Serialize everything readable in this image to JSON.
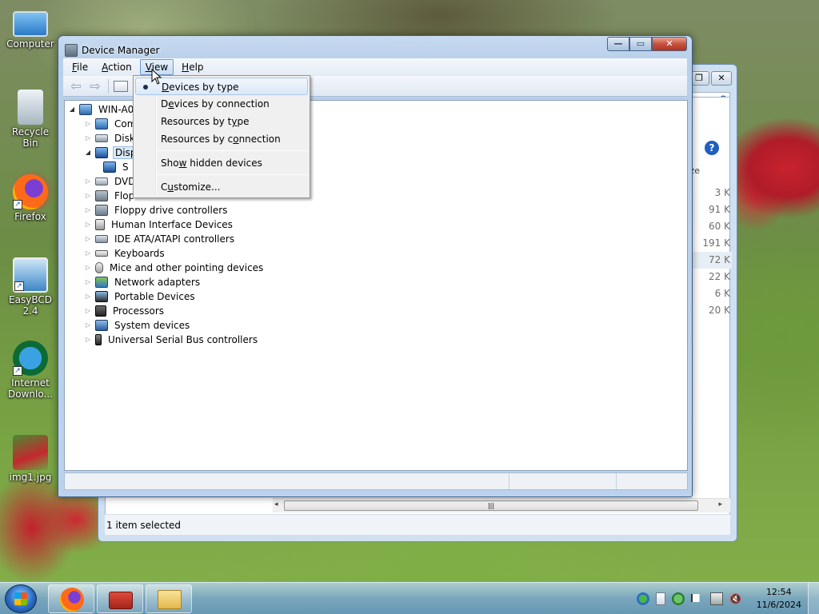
{
  "desktop": {
    "icons": [
      {
        "label": "Computer",
        "icon": "computer-icon"
      },
      {
        "label": "Recycle Bin",
        "icon": "recycle-bin-icon"
      },
      {
        "label": "Firefox",
        "icon": "firefox-icon"
      },
      {
        "label": "EasyBCD 2.4",
        "icon": "easybcd-icon"
      },
      {
        "label": "Internet Downlo...",
        "icon": "internet-download-manager-icon"
      },
      {
        "label": "img1.jpg",
        "icon": "image-file-icon"
      }
    ]
  },
  "background_window": {
    "sizes": [
      "3 K",
      "91 K",
      "60 K",
      "191 K",
      "72 K",
      "22 K",
      "6 K",
      "20 K"
    ],
    "column_fragment": "ze",
    "status": "1 item selected"
  },
  "device_manager": {
    "title": "Device Manager",
    "menu": {
      "file": {
        "pre": "",
        "acc": "F",
        "post": "ile"
      },
      "action": {
        "pre": "",
        "acc": "A",
        "post": "ction"
      },
      "view": {
        "pre": "",
        "acc": "V",
        "post": "iew"
      },
      "help": {
        "pre": "",
        "acc": "H",
        "post": "elp"
      }
    },
    "tree": {
      "root": "WIN-A0",
      "items": [
        {
          "label": "Com",
          "icon": "computer-icon"
        },
        {
          "label": "Disk",
          "icon": "disk-drive-icon"
        },
        {
          "label": "Disp",
          "icon": "display-adapter-icon",
          "expanded": true
        },
        {
          "label": "S",
          "icon": "display-adapter-icon",
          "child": true
        },
        {
          "label": "DVD",
          "icon": "dvd-drive-icon"
        },
        {
          "label": "Flop",
          "icon": "floppy-disk-icon"
        },
        {
          "label": "Floppy drive controllers",
          "icon": "floppy-controller-icon"
        },
        {
          "label": "Human Interface Devices",
          "icon": "hid-icon"
        },
        {
          "label": "IDE ATA/ATAPI controllers",
          "icon": "ide-controller-icon"
        },
        {
          "label": "Keyboards",
          "icon": "keyboard-icon"
        },
        {
          "label": "Mice and other pointing devices",
          "icon": "mouse-icon"
        },
        {
          "label": "Network adapters",
          "icon": "network-adapter-icon"
        },
        {
          "label": "Portable Devices",
          "icon": "portable-device-icon"
        },
        {
          "label": "Processors",
          "icon": "processor-icon"
        },
        {
          "label": "System devices",
          "icon": "system-devices-icon"
        },
        {
          "label": "Universal Serial Bus controllers",
          "icon": "usb-icon"
        }
      ]
    }
  },
  "view_menu": {
    "items": [
      {
        "pre": "",
        "acc": "D",
        "post": "evices by type",
        "checked": true
      },
      {
        "pre": "D",
        "acc": "e",
        "post": "vices by connection"
      },
      {
        "pre": "Resources by t",
        "acc": "y",
        "post": "pe"
      },
      {
        "pre": "Resources by c",
        "acc": "o",
        "post": "nnection"
      },
      {
        "pre": "Sho",
        "acc": "w",
        "post": " hidden devices"
      },
      {
        "pre": "C",
        "acc": "u",
        "post": "stomize..."
      }
    ]
  },
  "taskbar": {
    "apps": [
      "firefox-icon",
      "toolbox-icon",
      "file-explorer-icon"
    ],
    "tray_icons": [
      "network-icon",
      "clipboard-icon",
      "security-icon",
      "action-center-flag-icon",
      "printer-icon",
      "volume-muted-icon"
    ],
    "time": "12:54",
    "date": "11/6/2024"
  }
}
